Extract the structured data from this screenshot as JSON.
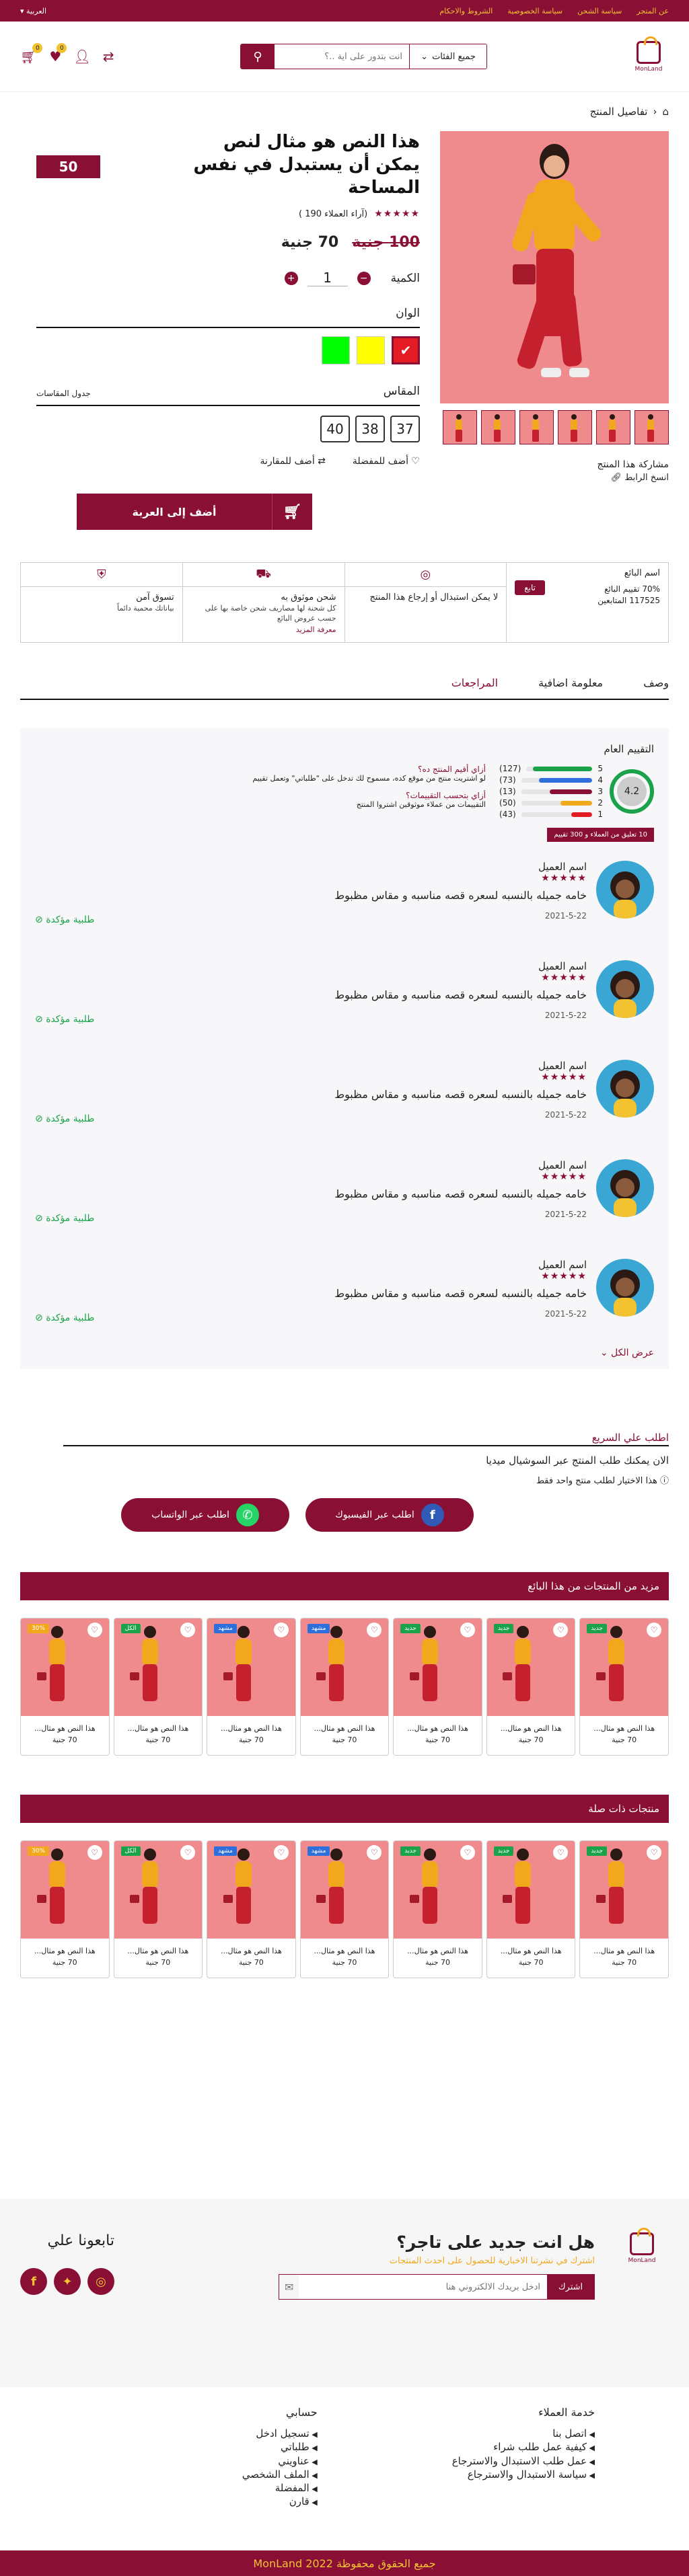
{
  "topbar": {
    "links": [
      "عن المتجر",
      "سياسة الشحن",
      "سياسة الخصوصية",
      "الشروط والاحكام"
    ],
    "lang": "العربية ▾"
  },
  "header": {
    "logo_text": "MonLand",
    "category_label": "جميع الفئات",
    "search_placeholder": "انت بتدور على اية ..؟",
    "wishlist_count": "0",
    "cart_count": "0"
  },
  "breadcrumb": {
    "label": "تفاصيل المنتج"
  },
  "product": {
    "title": "هذا النص هو مثال لنص يمكن أن يستبدل في نفس المساحة",
    "discount": "50",
    "stars": "★★★★★",
    "reviews_label": "(آراء العملاء 190 )",
    "old_price": "100 جنية",
    "price": "70 جنية",
    "qty_label": "الكمية",
    "qty_value": "1",
    "colors_label": "الوان",
    "colors": [
      "#e31b23",
      "#ffff00",
      "#00ff00"
    ],
    "size_label": "المقاس",
    "size_guide": "جدول المقاسات",
    "sizes": [
      "37",
      "38",
      "40"
    ],
    "wishlist_label": "أضف للمفضلة",
    "compare_label": "أضف للمقارنة",
    "add_to_cart": "أضف إلى العربة",
    "share_title": "مشاركة هذا المنتج",
    "copy_link": "انسخ الرابط"
  },
  "features": {
    "seller": {
      "title": "اسم البائع",
      "rating": "70% تقييم البائع",
      "followers": "117525 المتابعين",
      "follow": "تابع"
    },
    "items": [
      {
        "title": "لا يمكن استبدال أو إرجاع هذا المنتج",
        "desc": "",
        "more": ""
      },
      {
        "title": "شحن موثوق به",
        "desc": "كل شحنة لها مصاريف شحن خاصة بها على حسب عروض البائع",
        "more": "معرفة المزيد"
      },
      {
        "title": "تسوق آمن",
        "desc": "بياناتك محمية دائماً",
        "more": ""
      }
    ]
  },
  "tabs": [
    "وصف",
    "معلومة اضافية",
    "المراجعات"
  ],
  "reviews": {
    "summary_title": "التقييم العام",
    "avg": "4.2",
    "bars": [
      {
        "star": "5",
        "count": "(127)",
        "pct": 0.9,
        "color": "#1aa34a"
      },
      {
        "star": "4",
        "count": "(73)",
        "pct": 0.75,
        "color": "#2f6fdc"
      },
      {
        "star": "3",
        "count": "(13)",
        "pct": 0.6,
        "color": "#8a0f34"
      },
      {
        "star": "2",
        "count": "(50)",
        "pct": 0.45,
        "color": "#f2a81d"
      },
      {
        "star": "1",
        "count": "(43)",
        "pct": 0.3,
        "color": "#e31b23"
      }
    ],
    "hint1_title": "أزاي أقيم المنتج ده؟",
    "hint1_body": "لو اشتريت منتج من موقع كده، مسموح لك تدخل على \"طلباتي\" وتعمل تقييم",
    "hint2_title": "أزاي بتحسب التقييمات؟",
    "hint2_body": "التقييمات من عملاء موثوقين اشتروا المنتج",
    "rated_pill": "10 تعليق من العملاء و 300 تقييم",
    "items": [
      {
        "name": "اسم العميل",
        "stars": "★★★★★",
        "text": "خامه جميله بالنسبه لسعره قصه مناسبه و مقاس مظبوط",
        "date": "2021-5-22",
        "verified": "طلبية مؤكدة"
      },
      {
        "name": "اسم العميل",
        "stars": "★★★★★",
        "text": "خامه جميله بالنسبه لسعره قصه مناسبه و مقاس مظبوط",
        "date": "2021-5-22",
        "verified": "طلبية مؤكدة"
      },
      {
        "name": "اسم العميل",
        "stars": "★★★★★",
        "text": "خامه جميله بالنسبه لسعره قصه مناسبه و مقاس مظبوط",
        "date": "2021-5-22",
        "verified": "طلبية مؤكدة"
      },
      {
        "name": "اسم العميل",
        "stars": "★★★★★",
        "text": "خامه جميله بالنسبه لسعره قصه مناسبه و مقاس مظبوط",
        "date": "2021-5-22",
        "verified": "طلبية مؤكدة"
      },
      {
        "name": "اسم العميل",
        "stars": "★★★★★",
        "text": "خامه جميله بالنسبه لسعره قصه مناسبه و مقاس مظبوط",
        "date": "2021-5-22",
        "verified": "طلبية مؤكدة"
      }
    ],
    "show_all": "عرض الكل ⌄"
  },
  "fast_order": {
    "title": "اطلب علي السريع",
    "subtitle": "الان يمكنك طلب المنتج عبر السوشيال ميديا",
    "note": "هذا الاختيار لطلب منتج واحد فقط",
    "facebook": "اطلب عبر الفيسبوك",
    "whatsapp": "اطلب عبر الواتساب"
  },
  "carousels": [
    {
      "title": "مزيد من المنتجات من هذا البائع",
      "cards": [
        {
          "tag": "جديد",
          "tag_color": "#1aa34a",
          "title": "هذا النص هو مثال...",
          "price": "70 جنية"
        },
        {
          "tag": "جديد",
          "tag_color": "#1aa34a",
          "title": "هذا النص هو مثال...",
          "price": "70 جنية"
        },
        {
          "tag": "جديد",
          "tag_color": "#1aa34a",
          "title": "هذا النص هو مثال...",
          "price": "70 جنية"
        },
        {
          "tag": "مشهد",
          "tag_color": "#2f6fdc",
          "title": "هذا النص هو مثال...",
          "price": "70 جنية"
        },
        {
          "tag": "مشهد",
          "tag_color": "#2f6fdc",
          "title": "هذا النص هو مثال...",
          "price": "70 جنية"
        },
        {
          "tag": "الكل",
          "tag_color": "#1aa34a",
          "title": "هذا النص هو مثال...",
          "price": "70 جنية"
        },
        {
          "tag": "30%",
          "tag_color": "#f2a81d",
          "title": "هذا النص هو مثال...",
          "price": "70 جنية"
        }
      ]
    },
    {
      "title": "منتجات ذات صلة",
      "cards": [
        {
          "tag": "جديد",
          "tag_color": "#1aa34a",
          "title": "هذا النص هو مثال...",
          "price": "70 جنية"
        },
        {
          "tag": "جديد",
          "tag_color": "#1aa34a",
          "title": "هذا النص هو مثال...",
          "price": "70 جنية"
        },
        {
          "tag": "جديد",
          "tag_color": "#1aa34a",
          "title": "هذا النص هو مثال...",
          "price": "70 جنية"
        },
        {
          "tag": "مشهد",
          "tag_color": "#2f6fdc",
          "title": "هذا النص هو مثال...",
          "price": "70 جنية"
        },
        {
          "tag": "مشهد",
          "tag_color": "#2f6fdc",
          "title": "هذا النص هو مثال...",
          "price": "70 جنية"
        },
        {
          "tag": "الكل",
          "tag_color": "#1aa34a",
          "title": "هذا النص هو مثال...",
          "price": "70 جنية"
        },
        {
          "tag": "30%",
          "tag_color": "#f2a81d",
          "title": "هذا النص هو مثال...",
          "price": "70 جنية"
        }
      ]
    }
  ],
  "newsletter": {
    "title": "هل انت جديد على تاجر؟",
    "subtitle": "اشترك في نشرتنا الاخبارية للحصول على احدث المنتجات",
    "placeholder": "ادخل بريدك الالكتروني هنا",
    "button": "اشترك",
    "follow_title": "تابعونا علي",
    "logo_text": "MonLand"
  },
  "footer": {
    "service_title": "خدمة العملاء",
    "service_links": [
      "اتصل بنا",
      "كيفية عمل طلب شراء",
      "عمل طلب الاستبدال والاسترجاع",
      "سياسة الاستبدال والاسترجاع"
    ],
    "account_title": "حسابي",
    "account_links": [
      "تسجيل  ادخل",
      "طلباتي",
      "عناويني",
      "الملف الشخصي",
      "المفضلة",
      "قارن"
    ],
    "copyright": "جميع الحقوق محفوظة  MonLand 2022"
  },
  "colors": {
    "brand": "#8a0f34",
    "accent": "#f2c230",
    "success": "#1aa34a"
  }
}
